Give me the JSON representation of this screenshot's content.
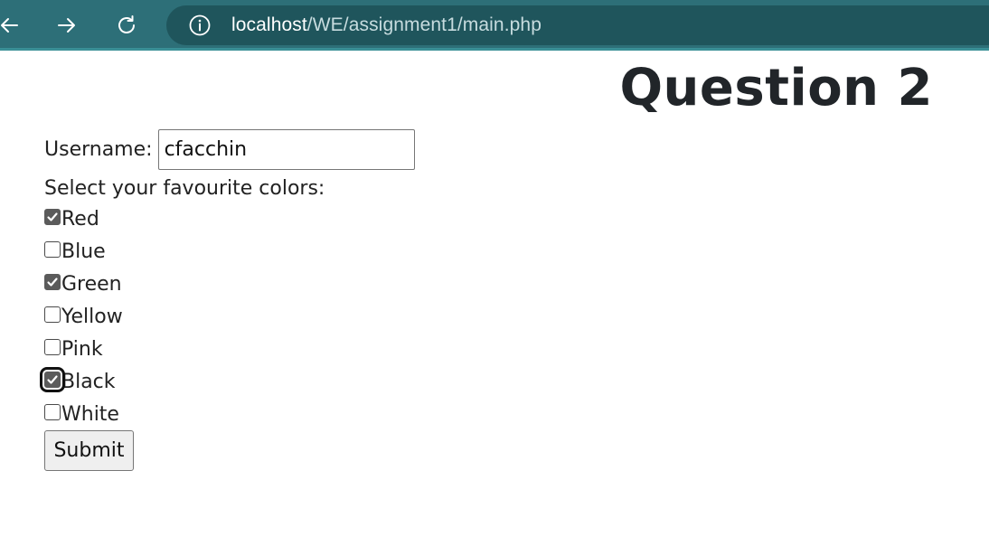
{
  "browser": {
    "url_host": "localhost",
    "url_path": "/WE/assignment1/main.php",
    "icons": [
      "back-arrow-icon",
      "forward-arrow-icon",
      "reload-icon",
      "info-icon"
    ]
  },
  "page": {
    "heading": "Question 2",
    "username_label": "Username:",
    "username_value": "cfacchin",
    "colors_prompt": "Select your favourite colors:",
    "colors": [
      {
        "label": "Red",
        "checked": true
      },
      {
        "label": "Blue",
        "checked": false
      },
      {
        "label": "Green",
        "checked": true
      },
      {
        "label": "Yellow",
        "checked": false
      },
      {
        "label": "Pink",
        "checked": false
      },
      {
        "label": "Black",
        "checked": true,
        "focused": true
      },
      {
        "label": "White",
        "checked": false
      }
    ],
    "submit_label": "Submit"
  },
  "theme": {
    "toolbar_bg": "#2d6f78",
    "address_bg": "#1f555c"
  }
}
